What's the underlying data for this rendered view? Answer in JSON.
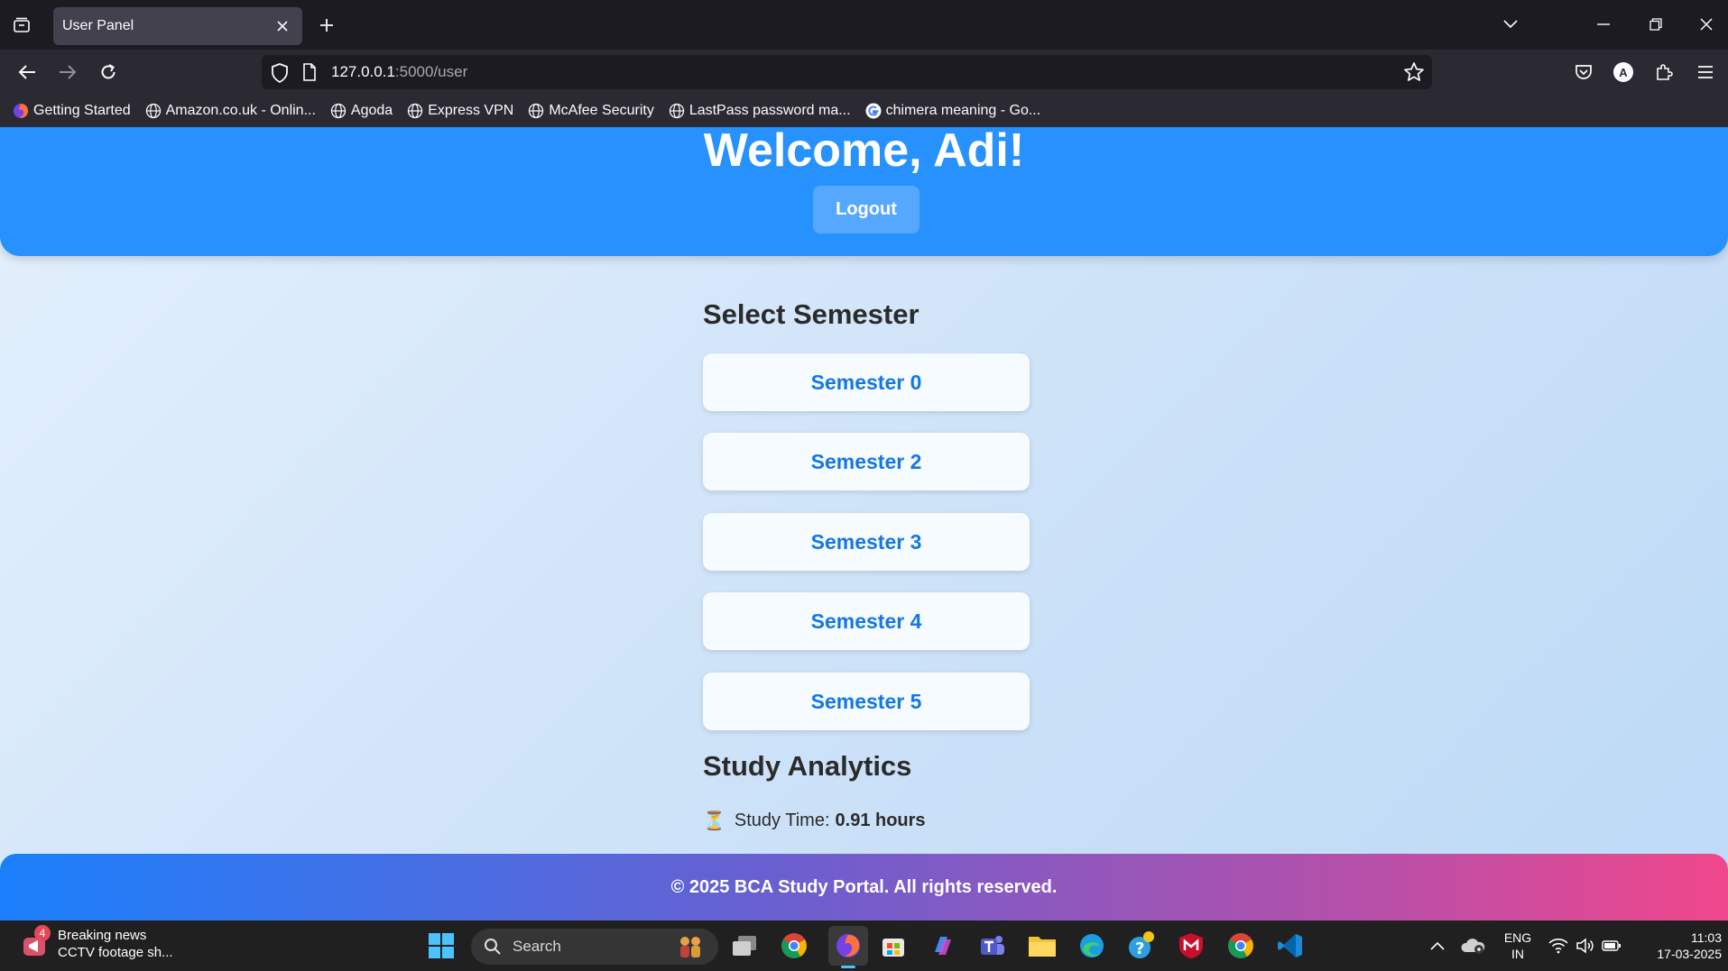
{
  "browser": {
    "tab_title": "User Panel",
    "url_host": "127.0.0.1",
    "url_path": ":5000/user",
    "bookmarks": [
      {
        "label": "Getting Started",
        "icon": "firefox-icon"
      },
      {
        "label": "Amazon.co.uk - Onlin...",
        "icon": "globe-icon"
      },
      {
        "label": "Agoda",
        "icon": "globe-icon"
      },
      {
        "label": "Express VPN",
        "icon": "globe-icon"
      },
      {
        "label": "McAfee Security",
        "icon": "globe-icon"
      },
      {
        "label": "LastPass password ma...",
        "icon": "globe-icon"
      },
      {
        "label": "chimera meaning - Go...",
        "icon": "google-icon"
      }
    ],
    "profile_initial": "A"
  },
  "page": {
    "welcome": "Welcome, Adi!",
    "logout_label": "Logout",
    "select_semester_title": "Select Semester",
    "semesters": [
      {
        "label": "Semester 0"
      },
      {
        "label": "Semester 2"
      },
      {
        "label": "Semester 3"
      },
      {
        "label": "Semester 4"
      },
      {
        "label": "Semester 5"
      }
    ],
    "analytics_title": "Study Analytics",
    "study_time_label": "Study Time:",
    "study_time_value": "0.91 hours",
    "hourglass": "⏳",
    "footer": "© 2025 BCA Study Portal. All rights reserved.",
    "colors": {
      "header": "#2791fe",
      "semester_text": "#1478e2"
    }
  },
  "taskbar": {
    "news_badge": "4",
    "news_title": "Breaking news",
    "news_subtitle": "CCTV footage sh...",
    "search_label": "Search",
    "lang_line1": "ENG",
    "lang_line2": "IN",
    "time": "11:03",
    "date": "17-03-2025"
  }
}
